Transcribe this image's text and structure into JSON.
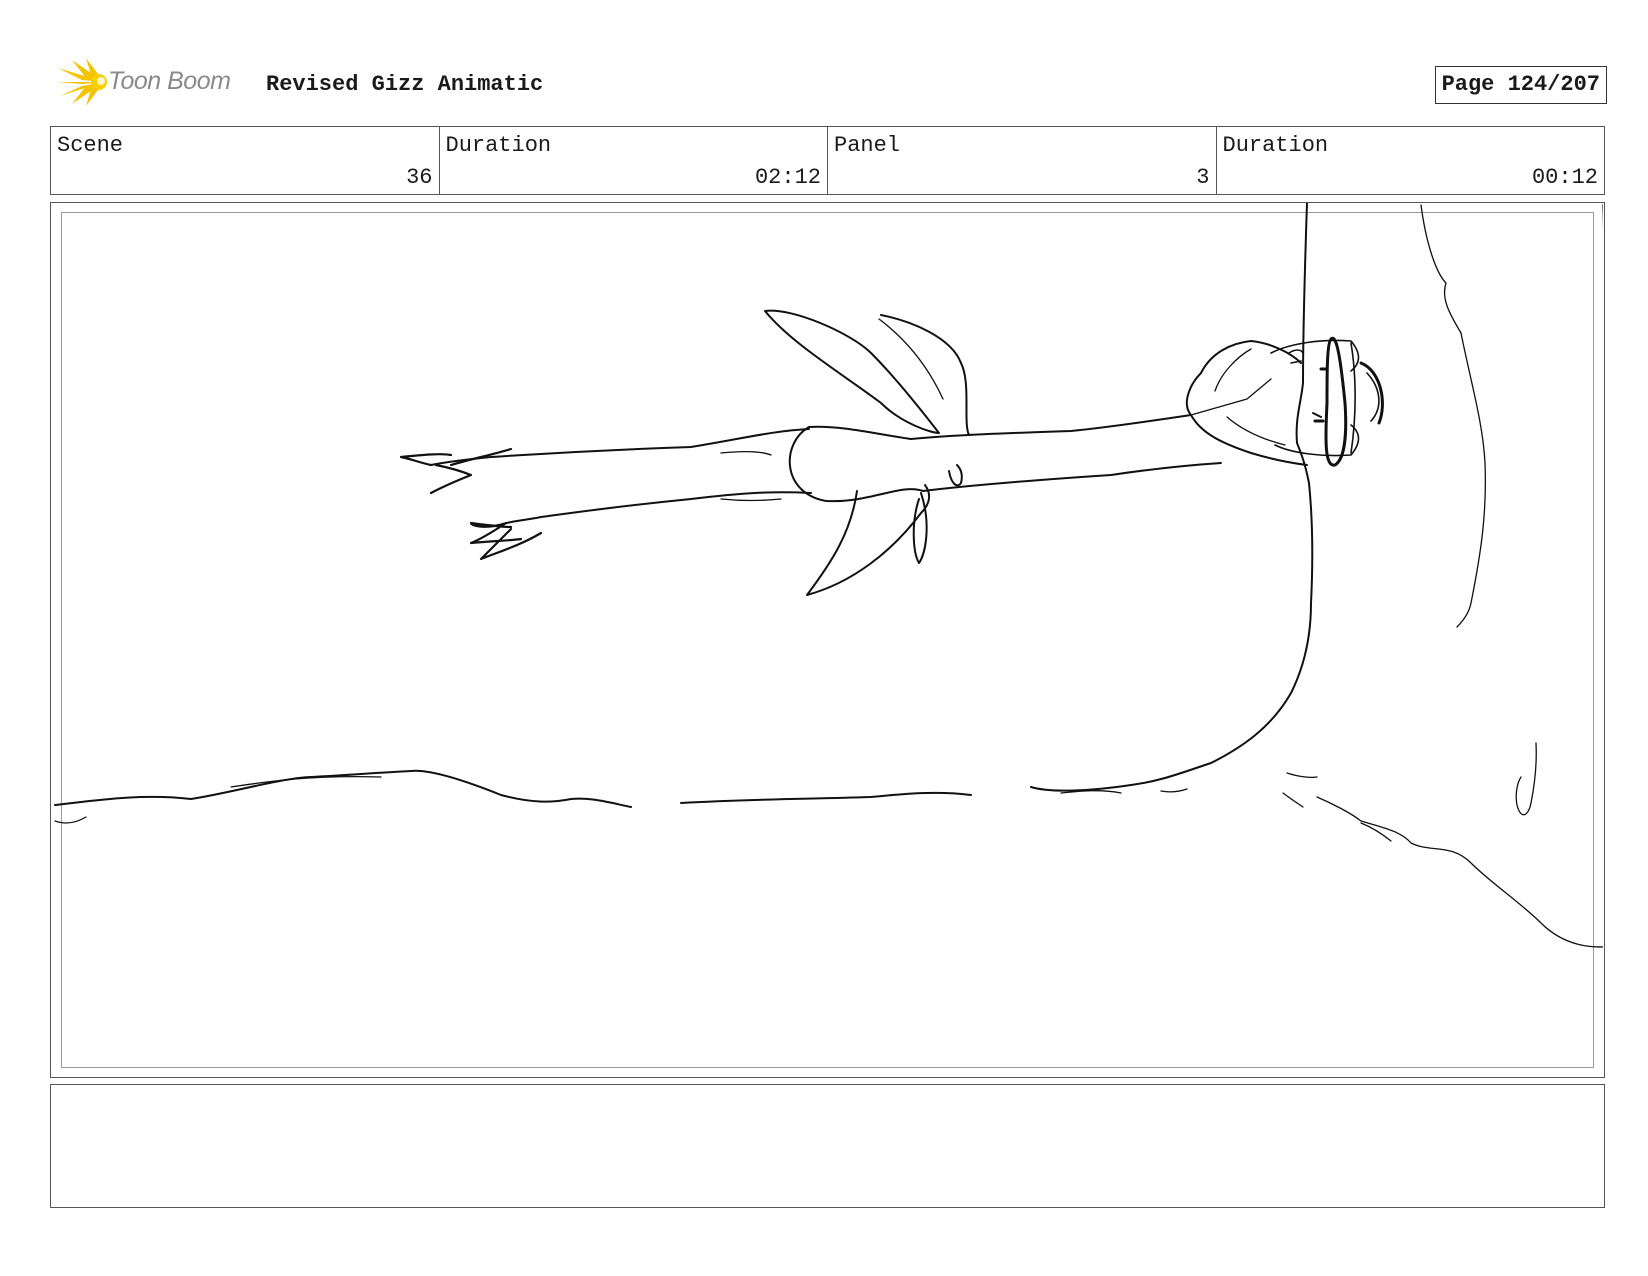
{
  "brand": {
    "logo_text": "Toon Boom",
    "logo_icon": "starburst-icon",
    "logo_color": "#F5C400"
  },
  "document": {
    "title": "Revised Gizz Animatic",
    "page_label": "Page 124/207"
  },
  "info": {
    "scene": {
      "label": "Scene",
      "value": "36"
    },
    "scene_duration": {
      "label": "Duration",
      "value": "02:12"
    },
    "panel": {
      "label": "Panel",
      "value": "3"
    },
    "panel_duration": {
      "label": "Duration",
      "value": "00:12"
    }
  },
  "panel": {
    "image": "storyboard-sketch"
  },
  "notes": {
    "text": ""
  }
}
